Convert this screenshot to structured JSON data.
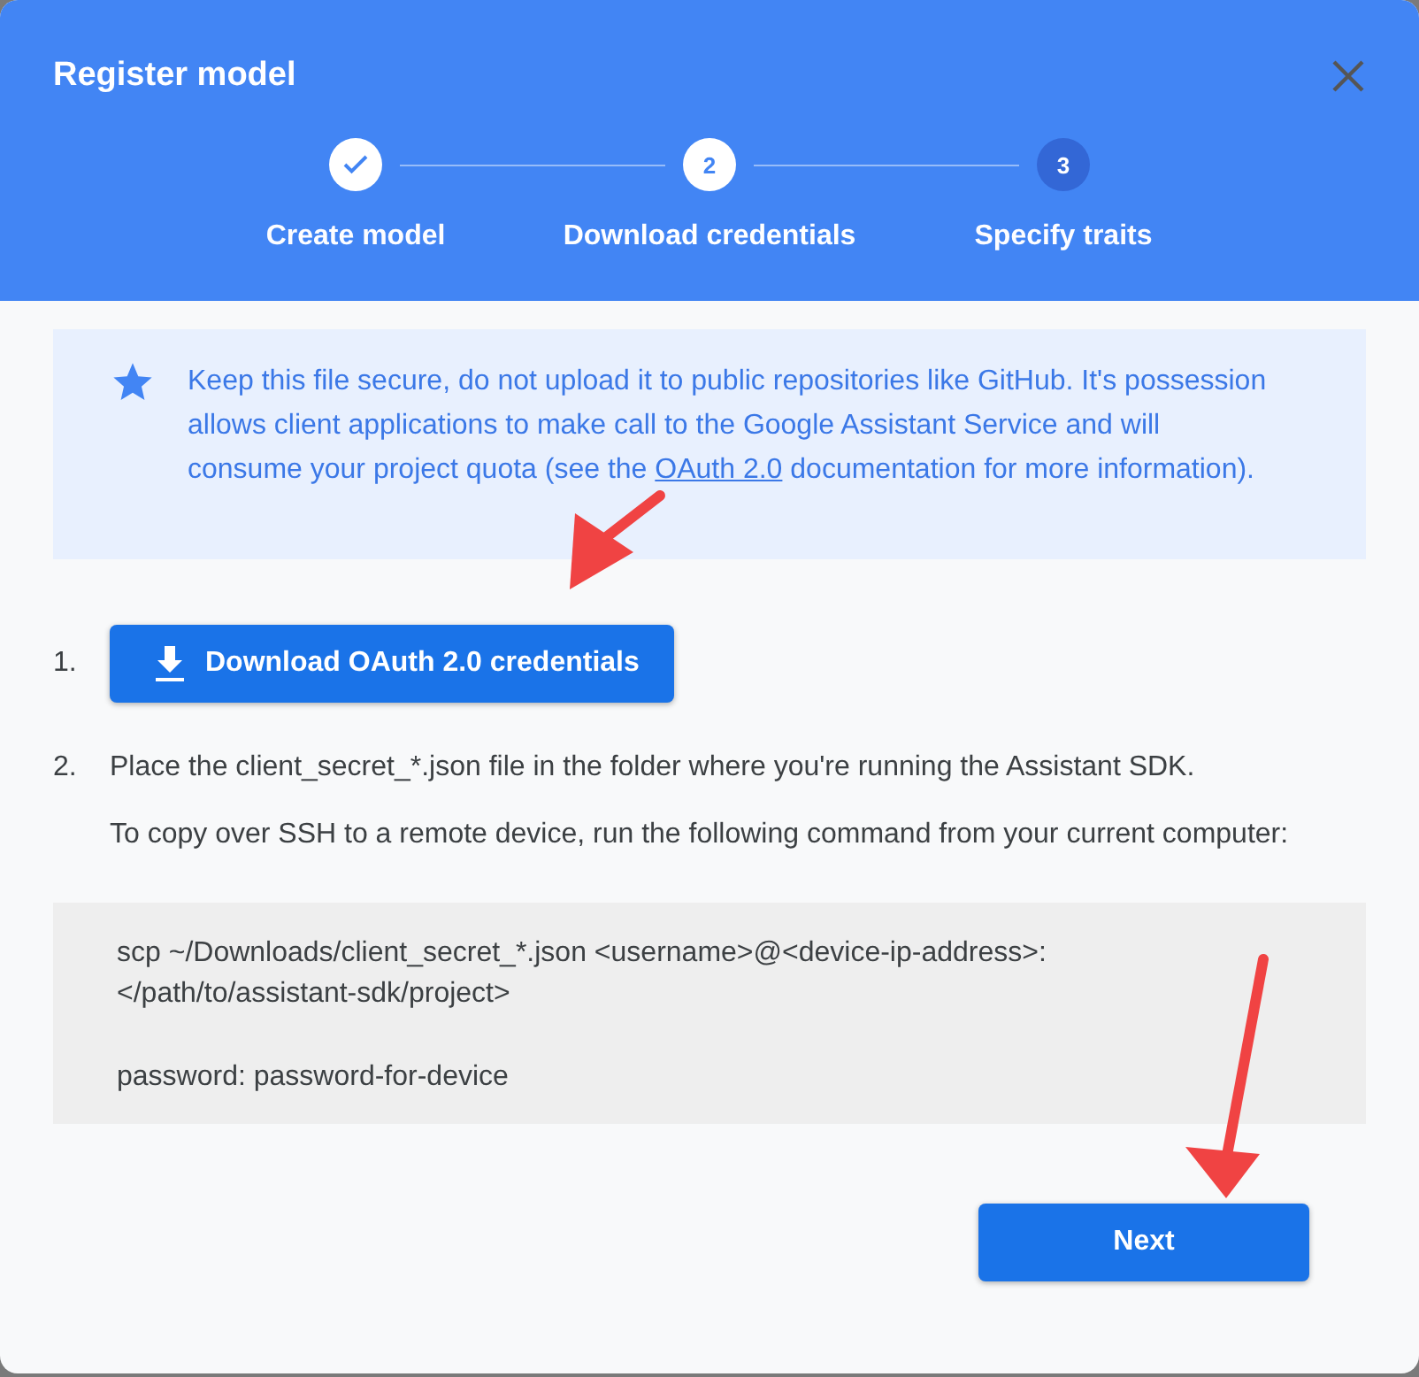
{
  "dialog": {
    "title": "Register model"
  },
  "steps": [
    {
      "label": "Create model",
      "completed": true,
      "selected": false
    },
    {
      "label": "Download credentials",
      "number": "2",
      "completed": false,
      "selected": true
    },
    {
      "label": "Specify traits",
      "number": "3",
      "completed": false,
      "selected": false
    }
  ],
  "notice": {
    "text_before": "Keep this file secure, do not upload it to public repositories like GitHub. It's possession allows client applications to make call to the Google Assistant Service and will consume your project quota (see the",
    "link": "OAuth 2.0",
    "text_after": "documentation for more information)."
  },
  "instructions": [
    {
      "marker": "1.",
      "kind": "button",
      "label": "Download OAuth 2.0 credentials"
    },
    {
      "marker": "2.",
      "kind": "text",
      "paragraphs": [
        "Place the client_secret_*.json file in the folder where you're running the Assistant SDK.",
        "To copy over SSH to a remote device, run the following command from your current computer:"
      ]
    }
  ],
  "code": {
    "command": "scp ~/Downloads/client_secret_*.json <username>@<device-ip-address>: </path/to/assistant-sdk/project>",
    "password_line": "password: password-for-device"
  },
  "buttons": [
    "Next"
  ]
}
